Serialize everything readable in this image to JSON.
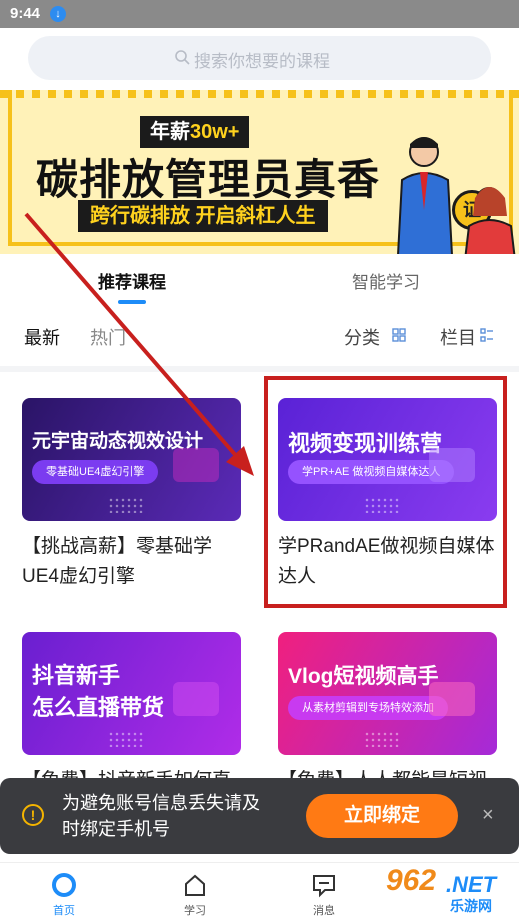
{
  "status_bar": {
    "time": "9:44",
    "download_icon": "download-icon"
  },
  "search": {
    "placeholder": "搜索你想要的课程",
    "icon": "search-icon"
  },
  "banner": {
    "tag_prefix": "年薪",
    "tag_highlight": "30w+",
    "headline": "碳排放管理员真香",
    "subtitle": "跨行碳排放 开启斜杠人生",
    "badge": "证"
  },
  "tabs": [
    {
      "label": "推荐课程",
      "active": true
    },
    {
      "label": "智能学习",
      "active": false
    }
  ],
  "filters": {
    "latest": "最新",
    "hot": "热门",
    "category": "分类",
    "column": "栏目"
  },
  "courses": [
    {
      "thumb_title": "元宇宙动态视效设计",
      "thumb_sub": "零基础UE4虚幻引擎",
      "title": "【挑战高薪】零基础学UE4虚幻引擎",
      "bg": "#3b1e8a"
    },
    {
      "thumb_title": "视频变现训练营",
      "thumb_sub": "学PR+AE 做视频自媒体达人",
      "title": "学PRandAE做视频自媒体达人",
      "bg": "#6b2be0"
    },
    {
      "thumb_title_line1": "抖音新手",
      "thumb_title_line2": "怎么直播带货",
      "title": "【免费】抖音新手如何直播带货",
      "bg": "#8a2be2"
    },
    {
      "thumb_title": "Vlog短视频高手",
      "thumb_sub": "从素材剪辑到专场特效添加",
      "title": "【免费】人人都能是短视频",
      "bg": "#e8238f"
    }
  ],
  "toast": {
    "message": "为避免账号信息丢失请及时绑定手机号",
    "button": "立即绑定",
    "close": "×"
  },
  "bottom_nav": [
    {
      "label": "首页",
      "icon": "home-circle-icon",
      "active": true
    },
    {
      "label": "学习",
      "icon": "house-icon",
      "active": false
    },
    {
      "label": "消息",
      "icon": "message-icon",
      "active": false
    }
  ],
  "watermark": {
    "number": "962",
    "net": ".NET",
    "site": "乐游网"
  },
  "colors": {
    "accent": "#1d8cf8",
    "orange": "#ff7a14",
    "highlight_red": "#c8201e",
    "banner_yellow": "#f6c11a"
  }
}
